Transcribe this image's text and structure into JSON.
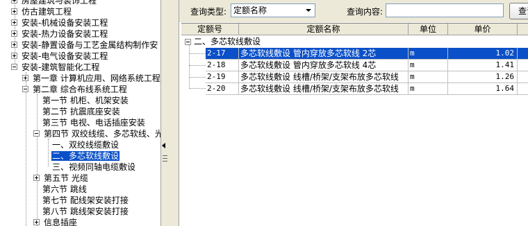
{
  "tree": {
    "items": [
      {
        "id": "housing-decor",
        "label": "房屋建筑与装饰工程",
        "state": "collapsed"
      },
      {
        "id": "antique",
        "label": "仿古建筑工程",
        "state": "collapsed"
      },
      {
        "id": "install-mech",
        "label": "安装-机械设备安装工程",
        "state": "collapsed"
      },
      {
        "id": "install-heat",
        "label": "安装-热力设备安装工程",
        "state": "collapsed"
      },
      {
        "id": "install-static",
        "label": "安装-静置设备与工艺金属结构制作安",
        "state": "collapsed"
      },
      {
        "id": "install-elec",
        "label": "安装-电气设备安装工程",
        "state": "collapsed"
      },
      {
        "id": "install-smart",
        "label": "安装-建筑智能化工程",
        "state": "expanded"
      },
      {
        "id": "ch1",
        "label": "第一章  计算机应用、网络系统工程",
        "state": "collapsed"
      },
      {
        "id": "ch2",
        "label": "第二章  综合布线系统工程",
        "state": "expanded"
      },
      {
        "id": "s1",
        "label": "第一节  机柜、机架安装",
        "state": "leaf"
      },
      {
        "id": "s2",
        "label": "第二节  抗震底座安装",
        "state": "leaf"
      },
      {
        "id": "s3",
        "label": "第三节  电视、电话插座安装",
        "state": "leaf"
      },
      {
        "id": "s4",
        "label": "第四节  双绞线缆、多芯软线、光",
        "state": "expanded"
      },
      {
        "id": "s4-1",
        "label": "一、双绞线缆敷设",
        "state": "leaf"
      },
      {
        "id": "s4-2",
        "label": "二、多芯软线敷设",
        "state": "leaf",
        "selected": true
      },
      {
        "id": "s4-3",
        "label": "三、视频同轴电缆敷设",
        "state": "leaf"
      },
      {
        "id": "s5",
        "label": "第五节  光缆",
        "state": "collapsed"
      },
      {
        "id": "s6",
        "label": "第六节  跳线",
        "state": "leaf"
      },
      {
        "id": "s7",
        "label": "第七节  配线架安装打接",
        "state": "leaf"
      },
      {
        "id": "s8",
        "label": "第八节  跳线架安装打接",
        "state": "leaf"
      },
      {
        "id": "s9",
        "label": "信息插座",
        "state": "collapsed"
      }
    ]
  },
  "query": {
    "type_label": "查询类型:",
    "type_value": "定额名称",
    "content_label": "查询内容:",
    "content_value": "",
    "button_label": "查询"
  },
  "grid": {
    "columns": [
      "定额号",
      "定额名称",
      "单位",
      "单价"
    ],
    "group_label": "二、多芯软线敷设",
    "rows": [
      {
        "code": "2-17",
        "name": "多芯软线敷设 管内穿放多芯软线 2芯",
        "unit": "m",
        "price": "1.02",
        "selected": true
      },
      {
        "code": "2-18",
        "name": "多芯软线敷设 管内穿放多芯软线 4芯",
        "unit": "m",
        "price": "1.41"
      },
      {
        "code": "2-19",
        "name": "多芯软线敷设 线槽/桥架/支架布放多芯软线",
        "unit": "m",
        "price": "1.26"
      },
      {
        "code": "2-20",
        "name": "多芯软线敷设 线槽/桥架/支架布放多芯软线",
        "unit": "m",
        "price": "1.64"
      }
    ]
  },
  "colors": {
    "selection": "#0a50c8",
    "panel": "#ece9d8",
    "grid_line": "#c0c0c0"
  }
}
